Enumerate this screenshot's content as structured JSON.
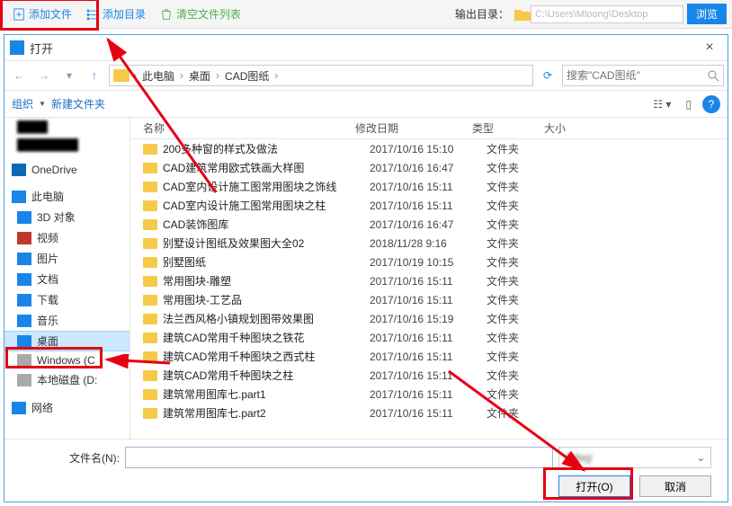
{
  "toolbar": {
    "add_file": "添加文件",
    "add_dir": "添加目录",
    "clear_list": "清空文件列表",
    "outdir_label": "输出目录：",
    "outdir_path": "C:\\Users\\Mloong\\Desktop",
    "browse": "浏览"
  },
  "dialog": {
    "title": "打开",
    "close": "×",
    "breadcrumb": [
      "此电脑",
      "桌面",
      "CAD图纸"
    ],
    "search_placeholder": "搜索\"CAD图纸\"",
    "organize": "组织",
    "new_folder": "新建文件夹",
    "filename_label": "文件名(N):",
    "filename_value": "",
    "filetype": "*.dwg",
    "open_btn": "打开(O)",
    "cancel_btn": "取消"
  },
  "columns": {
    "name": "名称",
    "date": "修改日期",
    "type": "类型",
    "size": "大小"
  },
  "tree": {
    "onedrive": "OneDrive",
    "this_pc": "此电脑",
    "items": [
      "3D 对象",
      "视频",
      "图片",
      "文档",
      "下载",
      "音乐",
      "桌面",
      "Windows (C",
      "本地磁盘 (D:"
    ],
    "network": "网络"
  },
  "files": [
    {
      "name": "200多种窗的样式及做法",
      "date": "2017/10/16 15:10",
      "type": "文件夹"
    },
    {
      "name": "CAD建筑常用欧式铁画大样图",
      "date": "2017/10/16 16:47",
      "type": "文件夹"
    },
    {
      "name": "CAD室内设计施工图常用图块之饰线",
      "date": "2017/10/16 15:11",
      "type": "文件夹"
    },
    {
      "name": "CAD室内设计施工图常用图块之柱",
      "date": "2017/10/16 15:11",
      "type": "文件夹"
    },
    {
      "name": "CAD装饰图库",
      "date": "2017/10/16 16:47",
      "type": "文件夹"
    },
    {
      "name": "别墅设计图纸及效果图大全02",
      "date": "2018/11/28 9:16",
      "type": "文件夹"
    },
    {
      "name": "别墅图纸",
      "date": "2017/10/19 10:15",
      "type": "文件夹"
    },
    {
      "name": "常用图块-雕塑",
      "date": "2017/10/16 15:11",
      "type": "文件夹"
    },
    {
      "name": "常用图块-工艺品",
      "date": "2017/10/16 15:11",
      "type": "文件夹"
    },
    {
      "name": "法兰西风格小镇规划图带效果图",
      "date": "2017/10/16 15:19",
      "type": "文件夹"
    },
    {
      "name": "建筑CAD常用千种图块之铁花",
      "date": "2017/10/16 15:11",
      "type": "文件夹"
    },
    {
      "name": "建筑CAD常用千种图块之西式柱",
      "date": "2017/10/16 15:11",
      "type": "文件夹"
    },
    {
      "name": "建筑CAD常用千种图块之柱",
      "date": "2017/10/16 15:11",
      "type": "文件夹"
    },
    {
      "name": "建筑常用图库七.part1",
      "date": "2017/10/16 15:11",
      "type": "文件夹"
    },
    {
      "name": "建筑常用图库七.part2",
      "date": "2017/10/16 15:11",
      "type": "文件夹"
    }
  ],
  "icon_colors": {
    "onedrive": "#0b6ab8",
    "this_pc": "#1a85e8",
    "3d": "#1a85e8",
    "video": "#c13828",
    "pic": "#1a85e8",
    "doc": "#1a85e8",
    "dl": "#1a85e8",
    "music": "#1a85e8",
    "desktop": "#1a85e8",
    "disk": "#aaa",
    "net": "#1a85e8"
  }
}
